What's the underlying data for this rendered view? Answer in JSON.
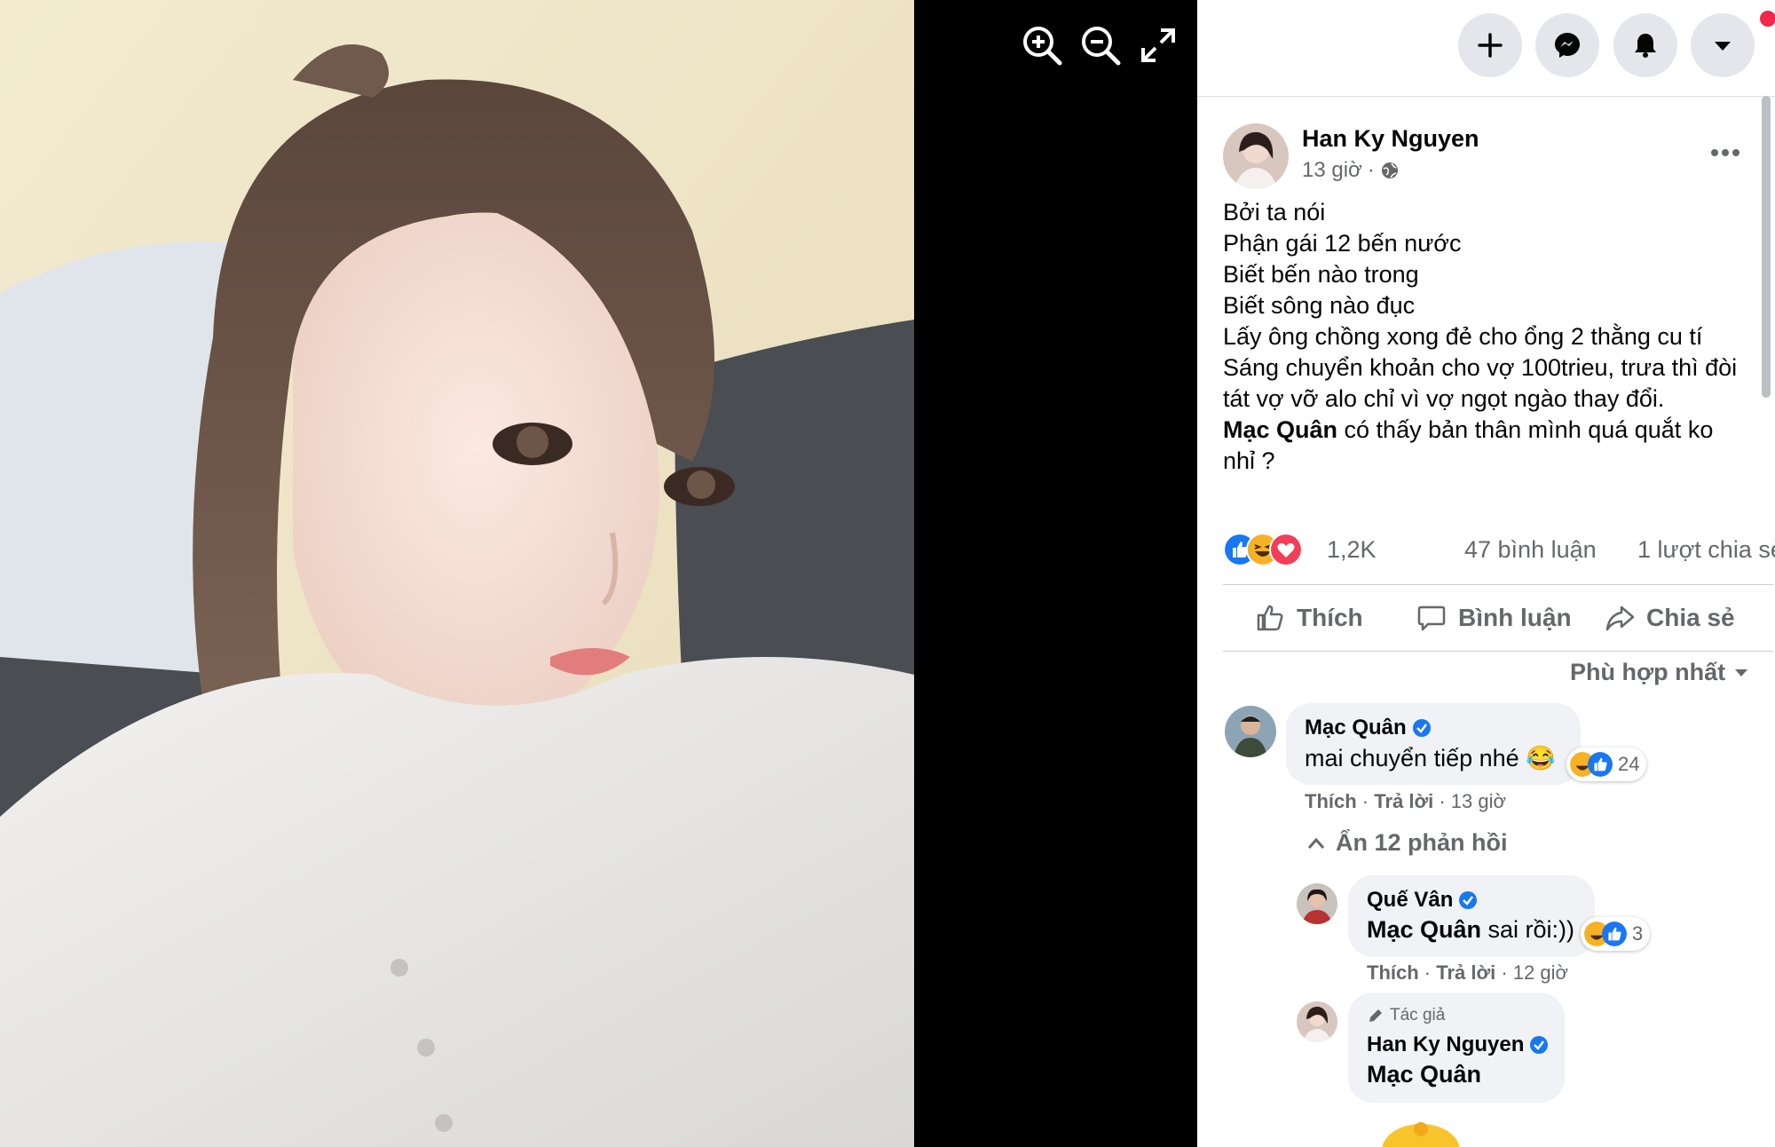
{
  "viewer": {
    "zoom_in_icon": "zoom-in-icon",
    "zoom_out_icon": "zoom-out-icon",
    "fullscreen_icon": "expand-icon"
  },
  "topbar": {
    "icons": [
      "plus-icon",
      "messenger-icon",
      "bell-icon",
      "caret-down-icon"
    ]
  },
  "post": {
    "author": "Han Ky Nguyen",
    "time": "13 giờ",
    "privacy_icon": "globe-icon",
    "lines": [
      "Bởi ta nói",
      "Phận gái 12 bến nước",
      "Biết bến nào trong",
      "Biết sông nào đục",
      "Lấy ông chồng xong đẻ cho ổng 2 thằng cu tí",
      "Sáng chuyển khoản cho vợ 100trieu, trưa thì đòi",
      "tát vợ vỡ alo chỉ vì vợ ngọt ngào thay đổi."
    ],
    "mention": "Mạc Quân",
    "mention_rest": " có thấy bản thân mình quá quắt ko",
    "last_line": "nhỉ ?",
    "reactions_count": "1,2K",
    "comments_count": "47 bình luận",
    "shares_count": "1 lượt chia sẻ"
  },
  "actions": {
    "like": "Thích",
    "comment": "Bình luận",
    "share": "Chia sẻ"
  },
  "sort_label": "Phù hợp nhất",
  "comments": {
    "c1": {
      "name": "Mạc Quân",
      "text": "mai chuyển tiếp nhé 😂",
      "react_count": "24",
      "like": "Thích",
      "reply": "Trả lời",
      "time": "13 giờ"
    },
    "hide_replies": "Ẩn 12 phản hồi",
    "r1": {
      "name": "Quế Vân",
      "mention": "Mạc Quân",
      "text": " sai rồi:))",
      "react_count": "3",
      "like": "Thích",
      "reply": "Trả lời",
      "time": "12 giờ"
    },
    "r2": {
      "badge": "Tác giả",
      "name": "Han Ky Nguyen",
      "mention": "Mạc Quân"
    }
  },
  "colors": {
    "brand_blue": "#1877f2",
    "secondary_text": "#65676b",
    "bubble": "#f0f2f5",
    "notification": "#f02849"
  }
}
